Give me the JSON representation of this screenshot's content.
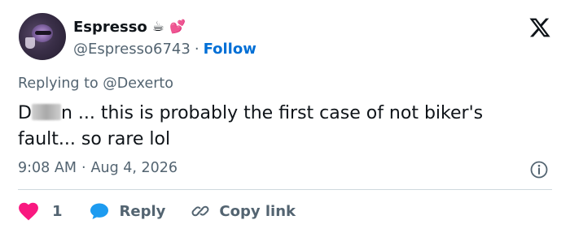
{
  "author": {
    "display_name": "Espresso",
    "name_emojis": [
      "☕",
      "💕"
    ],
    "handle": "@Espresso6743",
    "separator": "·",
    "follow_label": "Follow"
  },
  "tweet": {
    "replying_to": "Replying to @Dexerto",
    "text_start": "D",
    "text_rest": "n ... this is probably the first case of not biker's fault... so rare lol",
    "time": "9:08 AM",
    "date": "Aug 4, 2026"
  },
  "actions": {
    "like_count": "1",
    "reply_label": "Reply",
    "copy_label": "Copy link"
  },
  "colors": {
    "link": "#006fd6",
    "muted": "#536471",
    "like": "#f91880",
    "reply": "#1d9bf0",
    "divider": "#cfd9de"
  },
  "icons": {
    "platform": "x-logo-icon",
    "info": "info-icon",
    "like": "heart-icon",
    "reply": "speech-bubble-icon",
    "copy": "link-icon"
  }
}
